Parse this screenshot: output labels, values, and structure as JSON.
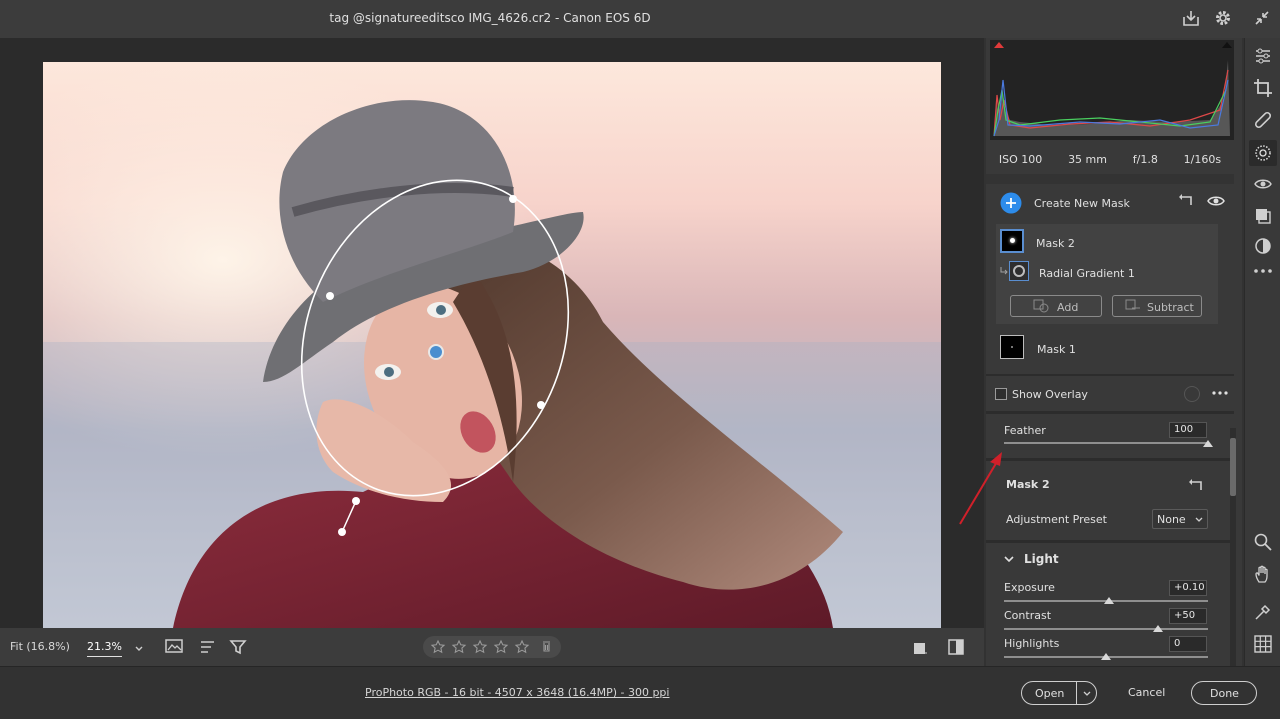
{
  "window": {
    "title": "tag @signatureeditsco IMG_4626.cr2  -  Canon EOS 6D"
  },
  "histogram": {
    "iso": "ISO 100",
    "focal": "35 mm",
    "aperture": "f/1.8",
    "shutter": "1/160s"
  },
  "masks": {
    "create_label": "Create New Mask",
    "items": [
      {
        "name": "Mask 2"
      },
      {
        "name": "Radial Gradient 1"
      },
      {
        "name": "Mask 1"
      }
    ],
    "add_label": "Add",
    "subtract_label": "Subtract",
    "show_overlay_label": "Show Overlay"
  },
  "feather": {
    "label": "Feather",
    "value": "100",
    "level": 1.0
  },
  "mask_section": {
    "title": "Mask 2",
    "preset_label": "Adjustment Preset",
    "preset_value": "None"
  },
  "light": {
    "title": "Light",
    "sliders": [
      {
        "label": "Exposure",
        "value": "+0.10",
        "level": 0.51
      },
      {
        "label": "Contrast",
        "value": "+50",
        "level": 0.75
      },
      {
        "label": "Highlights",
        "value": "0",
        "level": 0.5
      }
    ]
  },
  "bottom_bar": {
    "fit_label": "Fit (16.8%)",
    "zoom_label": "21.3%"
  },
  "footer": {
    "info_link": "ProPhoto RGB - 16 bit - 4507 x 3648 (16.4MP) - 300 ppi",
    "open_label": "Open",
    "cancel_label": "Cancel",
    "done_label": "Done"
  },
  "colors": {
    "accent": "#2d8ceb",
    "arrow": "#d0202a",
    "panel": "#393939"
  }
}
